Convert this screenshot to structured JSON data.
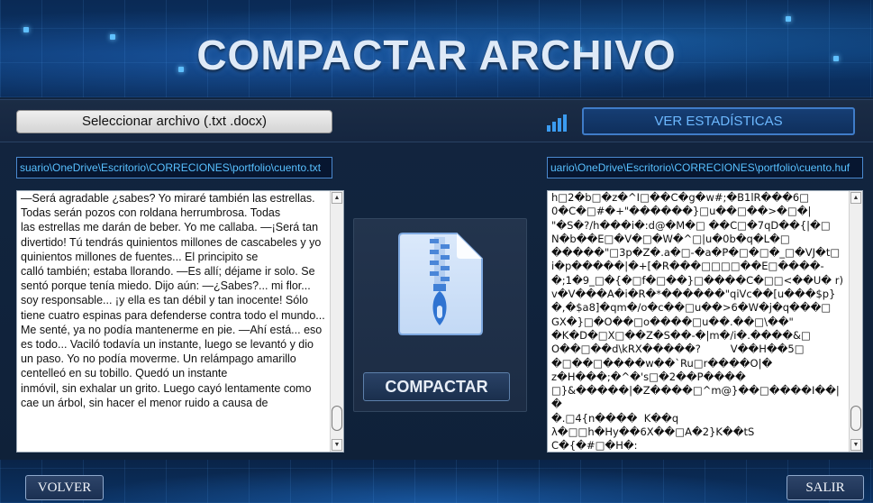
{
  "header": {
    "title": "COMPACTAR ARCHIVO"
  },
  "toolbar": {
    "select_file_label": "Seleccionar archivo (.txt .docx)",
    "stats_icon": "bar-chart-icon",
    "stats_label": "VER ESTADÍSTICAS"
  },
  "input_file": {
    "path": "C:\\Users\\usuario\\OneDrive\\Escritorio\\CORRECIONES\\portfolio\\cuento.txt",
    "path_visible": "suario\\OneDrive\\Escritorio\\CORRECIONES\\portfolio\\cuento.txt",
    "text": "—Será agradable ¿sabes? Yo miraré también las estrellas. Todas serán pozos con roldana herrumbrosa. Todas\nlas estrellas me darán de beber. Yo me callaba. —¡Será tan divertido! Tú tendrás quinientos millones de cascabeles y yo quinientos millones de fuentes... El principito se\ncalló también; estaba llorando. —Es allí; déjame ir solo. Se sentó porque tenía miedo. Dijo aún: —¿Sabes?... mi flor... soy responsable... ¡y ella es tan débil y tan inocente! Sólo tiene cuatro espinas para defenderse contra todo el mundo... Me senté, ya no podía mantenerme en pie. —Ahí está... eso es todo... Vaciló todavía un instante, luego se levantó y dio un paso. Yo no podía moverme. Un relámpago amarillo centelleó en su tobillo. Quedó un instante\ninmóvil, sin exhalar un grito. Luego cayó lentamente como cae un árbol, sin hacer el menor ruido a causa de"
  },
  "output_file": {
    "path_visible": "uario\\OneDrive\\Escritorio\\CORRECIONES\\portfolio\\cuento.huf",
    "text": "h□2�b□�z�^I□��C�g�w#;�B1lR���6□\n0�C�□#�+\"������}□u��□��>�□�|\n\"�S�?/h���i�:d@�M�□ ��C□�7qD��{|�□\nN�b��E□�V�□�W�^□|u�0b�q�L�□\n�����\"□3p�Z�.a�□-�a�P�□�□�_□�VJ�t□\ni�p�����|�+[�R���□□□□��E□����-\n�;1�9_□�{�□f�□��}□����C�□□<��U� r)\nv�V���A�i�R�*������\"qiVc��[u���$p}\n�,�$a8]�qm�/o�c��□u��>6�W�j�q���□\nGX�}□�O��□o����□u��.��□\\��\"\n�K�D�□X□��Z�S��-�|m�/i�.����&□\nO��□��d\\kRX�����?         V��H��5□\n�□��□����w��`Ru□r����O|�\nz�H���;�^�'s□�2��P����\n□}&�����|�Z����□^m@}��□����I��|�\n�.□4{n����  K��q\nλ�□□h�Hy��6X��□A�2}K��tS  C�{�#□�H�:\n□□��{��`�L�+��□��sK�ZFš�"
  },
  "center": {
    "icon": "zip-file-icon",
    "compact_label": "COMPACTAR"
  },
  "footer": {
    "back_label": "VOLVER",
    "exit_label": "SALIR"
  },
  "colors": {
    "accent": "#6cb8ff",
    "path_text": "#58c0ff",
    "title": "#dfeaf7"
  }
}
